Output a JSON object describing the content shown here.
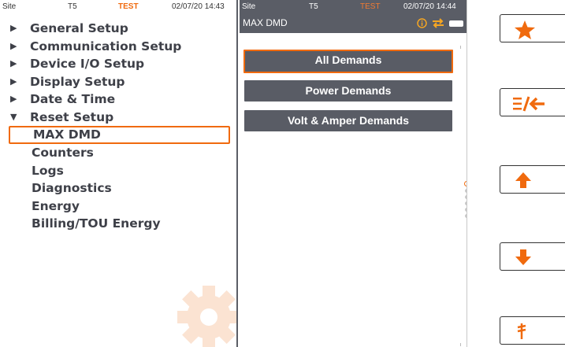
{
  "left_status": {
    "site": "Site",
    "device": "T5",
    "mode": "TEST",
    "datetime": "02/07/20 14:43"
  },
  "right_status": {
    "site": "Site",
    "device": "T5",
    "mode": "TEST",
    "datetime": "02/07/20 14:44"
  },
  "menu": {
    "items": [
      {
        "label": "General Setup"
      },
      {
        "label": "Communication Setup"
      },
      {
        "label": "Device I/O Setup"
      },
      {
        "label": "Display Setup"
      },
      {
        "label": "Date & Time"
      },
      {
        "label": "Reset Setup"
      }
    ],
    "sub_items": [
      {
        "label": "MAX DMD"
      },
      {
        "label": "Counters"
      },
      {
        "label": "Logs"
      },
      {
        "label": "Diagnostics"
      },
      {
        "label": "Energy"
      },
      {
        "label": "Billing/TOU Energy"
      }
    ]
  },
  "panel": {
    "title": "MAX DMD",
    "buttons": [
      {
        "label": "All Demands"
      },
      {
        "label": "Power Demands"
      },
      {
        "label": "Volt & Amper Demands"
      }
    ]
  },
  "hardware_buttons": [
    "star-icon",
    "menu-back-icon",
    "arrow-up-icon",
    "arrow-down-icon",
    "plug-icon"
  ],
  "colors": {
    "accent": "#f06a0e",
    "bar": "#5a5d66",
    "text": "#3e4048"
  }
}
